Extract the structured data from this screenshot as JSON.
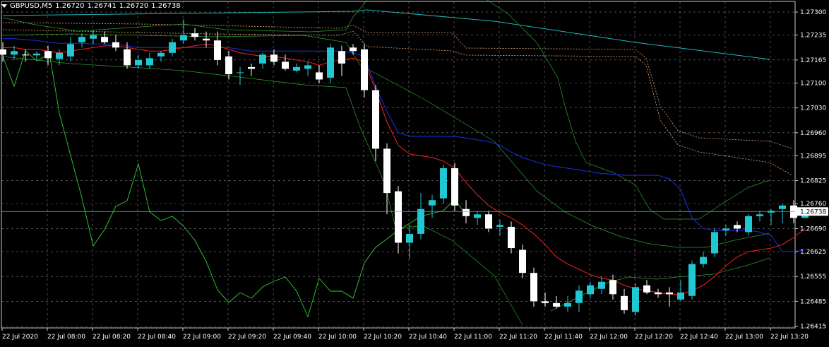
{
  "header": {
    "symbol": "GBPUSD,M5",
    "open": "1.26720",
    "high": "1.26741",
    "low": "1.26720",
    "close": "1.26738"
  },
  "current_price": "1.26738",
  "colors": {
    "background": "#000000",
    "grid": "#b4b4b4",
    "bull_candle": "#1fc8d2",
    "bear_candle": "#ffffff",
    "ma_fast": "#e01e1e",
    "ma_slow": "#1a2ad8",
    "band": "#2ca02c",
    "oscillator": "#33cc33",
    "long_ma": "#21b6b6",
    "envelope": "#e8a77a",
    "price_line": "#3fb9bf"
  },
  "chart_data": {
    "type": "candlestick",
    "ylim": [
      1.2641,
      1.2733
    ],
    "y_ticks": [
      "1.27300",
      "1.27235",
      "1.27165",
      "1.27100",
      "1.27030",
      "1.26960",
      "1.26895",
      "1.26825",
      "1.26760",
      "1.26690",
      "1.26625",
      "1.26555",
      "1.26485",
      "1.26415"
    ],
    "x_ticks": [
      "22 Jul 2020",
      "22 Jul 08:00",
      "22 Jul 08:20",
      "22 Jul 08:40",
      "22 Jul 09:00",
      "22 Jul 09:20",
      "22 Jul 09:40",
      "22 Jul 10:00",
      "22 Jul 10:20",
      "22 Jul 10:40",
      "22 Jul 11:00",
      "22 Jul 11:20",
      "22 Jul 11:40",
      "22 Jul 12:00",
      "22 Jul 12:20",
      "22 Jul 12:40",
      "22 Jul 13:00",
      "22 Jul 13:20"
    ],
    "candles": [
      {
        "o": 1.27195,
        "h": 1.27215,
        "l": 1.2716,
        "c": 1.2718
      },
      {
        "o": 1.2718,
        "h": 1.27205,
        "l": 1.27165,
        "c": 1.2719
      },
      {
        "o": 1.2718,
        "h": 1.27195,
        "l": 1.2716,
        "c": 1.27178
      },
      {
        "o": 1.27178,
        "h": 1.2719,
        "l": 1.27165,
        "c": 1.27183
      },
      {
        "o": 1.2719,
        "h": 1.27205,
        "l": 1.2715,
        "c": 1.2717
      },
      {
        "o": 1.27168,
        "h": 1.27195,
        "l": 1.2715,
        "c": 1.27185
      },
      {
        "o": 1.27175,
        "h": 1.2723,
        "l": 1.2716,
        "c": 1.2721
      },
      {
        "o": 1.27215,
        "h": 1.2724,
        "l": 1.272,
        "c": 1.2723
      },
      {
        "o": 1.27225,
        "h": 1.2725,
        "l": 1.2721,
        "c": 1.27235
      },
      {
        "o": 1.2723,
        "h": 1.27245,
        "l": 1.2721,
        "c": 1.27215
      },
      {
        "o": 1.27215,
        "h": 1.27235,
        "l": 1.2719,
        "c": 1.272
      },
      {
        "o": 1.27195,
        "h": 1.27215,
        "l": 1.2714,
        "c": 1.2715
      },
      {
        "o": 1.2715,
        "h": 1.2718,
        "l": 1.2714,
        "c": 1.27165
      },
      {
        "o": 1.2715,
        "h": 1.27185,
        "l": 1.2714,
        "c": 1.2717
      },
      {
        "o": 1.27175,
        "h": 1.2719,
        "l": 1.2716,
        "c": 1.27185
      },
      {
        "o": 1.27185,
        "h": 1.27225,
        "l": 1.27175,
        "c": 1.27215
      },
      {
        "o": 1.2722,
        "h": 1.2728,
        "l": 1.2721,
        "c": 1.27235
      },
      {
        "o": 1.2724,
        "h": 1.27255,
        "l": 1.2722,
        "c": 1.2723
      },
      {
        "o": 1.27225,
        "h": 1.27245,
        "l": 1.272,
        "c": 1.2722
      },
      {
        "o": 1.2722,
        "h": 1.27245,
        "l": 1.2715,
        "c": 1.27165
      },
      {
        "o": 1.27175,
        "h": 1.2719,
        "l": 1.2711,
        "c": 1.27125
      },
      {
        "o": 1.2713,
        "h": 1.27145,
        "l": 1.27095,
        "c": 1.2713
      },
      {
        "o": 1.27145,
        "h": 1.27155,
        "l": 1.2712,
        "c": 1.2714
      },
      {
        "o": 1.27155,
        "h": 1.27185,
        "l": 1.2714,
        "c": 1.2718
      },
      {
        "o": 1.2718,
        "h": 1.27195,
        "l": 1.2715,
        "c": 1.2716
      },
      {
        "o": 1.2716,
        "h": 1.2718,
        "l": 1.27135,
        "c": 1.2714
      },
      {
        "o": 1.27135,
        "h": 1.27155,
        "l": 1.2713,
        "c": 1.27145
      },
      {
        "o": 1.2714,
        "h": 1.2716,
        "l": 1.2712,
        "c": 1.2715
      },
      {
        "o": 1.2713,
        "h": 1.2715,
        "l": 1.271,
        "c": 1.2711
      },
      {
        "o": 1.27115,
        "h": 1.2721,
        "l": 1.271,
        "c": 1.272
      },
      {
        "o": 1.2719,
        "h": 1.27205,
        "l": 1.2712,
        "c": 1.27155
      },
      {
        "o": 1.272,
        "h": 1.2721,
        "l": 1.2718,
        "c": 1.2719
      },
      {
        "o": 1.27195,
        "h": 1.2721,
        "l": 1.2706,
        "c": 1.2708
      },
      {
        "o": 1.2708,
        "h": 1.27095,
        "l": 1.2688,
        "c": 1.26915
      },
      {
        "o": 1.26915,
        "h": 1.2693,
        "l": 1.2673,
        "c": 1.2679
      },
      {
        "o": 1.26795,
        "h": 1.2681,
        "l": 1.2662,
        "c": 1.2665
      },
      {
        "o": 1.2665,
        "h": 1.267,
        "l": 1.26605,
        "c": 1.26675
      },
      {
        "o": 1.26675,
        "h": 1.2679,
        "l": 1.2666,
        "c": 1.26745
      },
      {
        "o": 1.26755,
        "h": 1.26785,
        "l": 1.2672,
        "c": 1.2677
      },
      {
        "o": 1.26775,
        "h": 1.2687,
        "l": 1.2676,
        "c": 1.2686
      },
      {
        "o": 1.2686,
        "h": 1.26875,
        "l": 1.2674,
        "c": 1.26755
      },
      {
        "o": 1.26745,
        "h": 1.2677,
        "l": 1.26705,
        "c": 1.26725
      },
      {
        "o": 1.2672,
        "h": 1.2674,
        "l": 1.267,
        "c": 1.2673
      },
      {
        "o": 1.2673,
        "h": 1.2674,
        "l": 1.2668,
        "c": 1.2669
      },
      {
        "o": 1.26695,
        "h": 1.26715,
        "l": 1.2667,
        "c": 1.267
      },
      {
        "o": 1.26695,
        "h": 1.2671,
        "l": 1.2662,
        "c": 1.26635
      },
      {
        "o": 1.2663,
        "h": 1.26645,
        "l": 1.2655,
        "c": 1.26565
      },
      {
        "o": 1.26565,
        "h": 1.2658,
        "l": 1.2647,
        "c": 1.26485
      },
      {
        "o": 1.26485,
        "h": 1.2651,
        "l": 1.2647,
        "c": 1.2648
      },
      {
        "o": 1.2648,
        "h": 1.265,
        "l": 1.26465,
        "c": 1.2647
      },
      {
        "o": 1.2647,
        "h": 1.265,
        "l": 1.26455,
        "c": 1.2648
      },
      {
        "o": 1.2648,
        "h": 1.2653,
        "l": 1.26455,
        "c": 1.26515
      },
      {
        "o": 1.26505,
        "h": 1.2654,
        "l": 1.26495,
        "c": 1.2653
      },
      {
        "o": 1.2652,
        "h": 1.26555,
        "l": 1.26505,
        "c": 1.2654
      },
      {
        "o": 1.26545,
        "h": 1.2656,
        "l": 1.2649,
        "c": 1.26505
      },
      {
        "o": 1.265,
        "h": 1.2652,
        "l": 1.2645,
        "c": 1.2646
      },
      {
        "o": 1.26455,
        "h": 1.26535,
        "l": 1.26445,
        "c": 1.26525
      },
      {
        "o": 1.2653,
        "h": 1.26545,
        "l": 1.26505,
        "c": 1.2651
      },
      {
        "o": 1.2651,
        "h": 1.2652,
        "l": 1.26495,
        "c": 1.26505
      },
      {
        "o": 1.2651,
        "h": 1.26525,
        "l": 1.2647,
        "c": 1.26505
      },
      {
        "o": 1.2649,
        "h": 1.26545,
        "l": 1.26485,
        "c": 1.2651
      },
      {
        "o": 1.265,
        "h": 1.266,
        "l": 1.2649,
        "c": 1.2659
      },
      {
        "o": 1.2659,
        "h": 1.26625,
        "l": 1.2658,
        "c": 1.2661
      },
      {
        "o": 1.2662,
        "h": 1.2669,
        "l": 1.2661,
        "c": 1.2668
      },
      {
        "o": 1.26685,
        "h": 1.267,
        "l": 1.2667,
        "c": 1.2669
      },
      {
        "o": 1.267,
        "h": 1.2671,
        "l": 1.2668,
        "c": 1.2669
      },
      {
        "o": 1.2668,
        "h": 1.2673,
        "l": 1.2667,
        "c": 1.26725
      },
      {
        "o": 1.26725,
        "h": 1.2674,
        "l": 1.2671,
        "c": 1.2673
      },
      {
        "o": 1.26735,
        "h": 1.26745,
        "l": 1.267,
        "c": 1.2674
      },
      {
        "o": 1.26745,
        "h": 1.2676,
        "l": 1.26705,
        "c": 1.26755
      },
      {
        "o": 1.26755,
        "h": 1.2677,
        "l": 1.26705,
        "c": 1.2672
      },
      {
        "o": 1.2672,
        "h": 1.26741,
        "l": 1.2672,
        "c": 1.26738
      }
    ],
    "ma_fast": [
      1.272,
      1.272,
      1.27195,
      1.27195,
      1.2719,
      1.27185,
      1.2719,
      1.27195,
      1.272,
      1.27205,
      1.27205,
      1.272,
      1.27195,
      1.2719,
      1.2719,
      1.27195,
      1.272,
      1.27205,
      1.2721,
      1.27205,
      1.27195,
      1.27185,
      1.2718,
      1.27175,
      1.27175,
      1.2717,
      1.27165,
      1.2716,
      1.2715,
      1.2716,
      1.27165,
      1.2717,
      1.2716,
      1.2708,
      1.2699,
      1.26925,
      1.269,
      1.26895,
      1.2689,
      1.2688,
      1.2686,
      1.2682,
      1.26785,
      1.26755,
      1.26735,
      1.2672,
      1.267,
      1.26675,
      1.26645,
      1.2661,
      1.2659,
      1.26575,
      1.2656,
      1.2655,
      1.26545,
      1.2653,
      1.2652,
      1.26515,
      1.2651,
      1.26505,
      1.26505,
      1.26515,
      1.2653,
      1.26555,
      1.26585,
      1.2661,
      1.26625,
      1.2663,
      1.26635,
      1.26645,
      1.26665,
      1.2669
    ],
    "ma_slow": [
      1.27225,
      1.27225,
      1.27222,
      1.2722,
      1.27215,
      1.27212,
      1.27212,
      1.27212,
      1.2721,
      1.2721,
      1.2721,
      1.27205,
      1.272,
      1.272,
      1.272,
      1.272,
      1.272,
      1.272,
      1.272,
      1.272,
      1.272,
      1.27195,
      1.2719,
      1.2719,
      1.2719,
      1.2719,
      1.2719,
      1.2719,
      1.2719,
      1.2719,
      1.2719,
      1.27185,
      1.27175,
      1.2709,
      1.2702,
      1.2696,
      1.2695,
      1.2695,
      1.2695,
      1.2695,
      1.2695,
      1.26945,
      1.2694,
      1.26935,
      1.26925,
      1.26905,
      1.2689,
      1.2688,
      1.2687,
      1.26865,
      1.2686,
      1.26855,
      1.2685,
      1.26845,
      1.26843,
      1.2684,
      1.2684,
      1.2684,
      1.2684,
      1.2683,
      1.268,
      1.2672,
      1.2669,
      1.26685,
      1.26685,
      1.26685,
      1.26685,
      1.2668,
      1.2667,
      1.26625,
      1.26625,
      1.2663
    ]
  }
}
